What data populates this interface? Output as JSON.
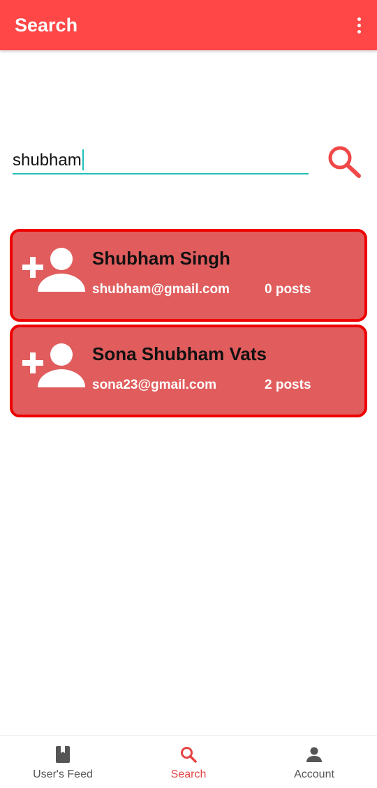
{
  "app_bar": {
    "title": "Search",
    "overflow_icon": "more-vert-icon",
    "background_color": "#FF4747"
  },
  "search": {
    "value": "shubham",
    "button_icon": "search-icon",
    "underline_color": "#1FBFB8"
  },
  "results": [
    {
      "icon": "person-add-icon",
      "name": "Shubham  Singh",
      "email": "shubham@gmail.com",
      "posts": "0 posts"
    },
    {
      "icon": "person-add-icon",
      "name": "Sona Shubham Vats",
      "email": "sona23@gmail.com",
      "posts": "2 posts"
    }
  ],
  "card_colors": {
    "background": "#E15D5D",
    "border": "#EE0000"
  },
  "bottom_nav": {
    "items": [
      {
        "label": "User's Feed",
        "icon": "book-icon",
        "active": false
      },
      {
        "label": "Search",
        "icon": "search-icon",
        "active": true
      },
      {
        "label": "Account",
        "icon": "person-icon",
        "active": false
      }
    ],
    "active_color": "#E64545",
    "inactive_color": "#555555"
  }
}
